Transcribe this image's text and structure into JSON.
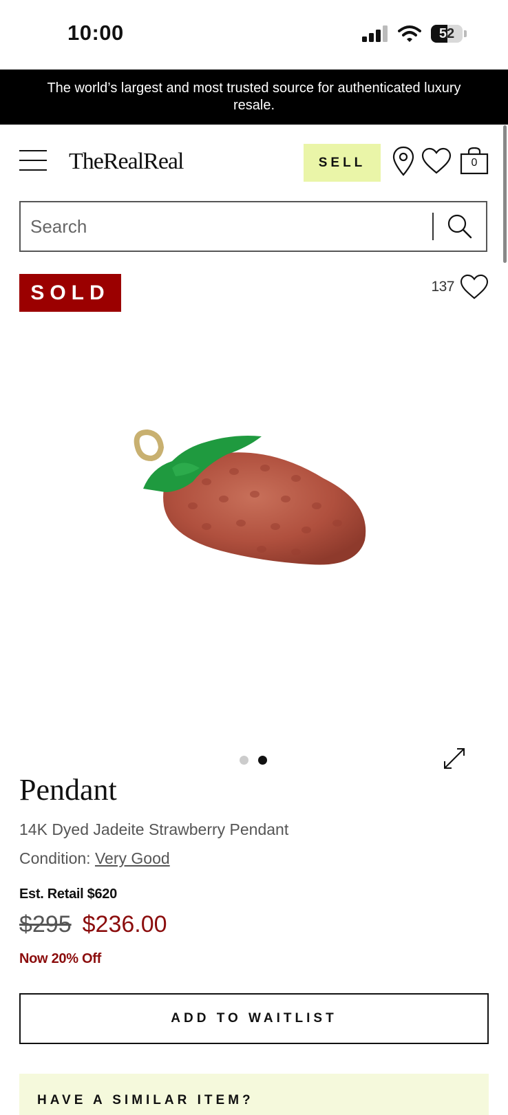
{
  "status_bar": {
    "time": "10:00",
    "battery": "52",
    "battery_level": 0.52
  },
  "banner": {
    "text": "The world’s largest and most trusted source for authenticated luxury resale."
  },
  "header": {
    "logo": "TheRealReal",
    "sell_label": "SELL",
    "bag_count": "0"
  },
  "search": {
    "placeholder": "Search"
  },
  "product": {
    "sold_label": "SOLD",
    "favorite_count": "137",
    "gallery": {
      "total_images": 2,
      "active_index": 1
    },
    "title": "Pendant",
    "subtitle": "14K Dyed Jadeite Strawberry Pendant",
    "condition_label": "Condition:",
    "condition_value": "Very Good",
    "est_retail": "Est. Retail $620",
    "original_price": "$295",
    "sale_price": "$236.00",
    "discount_text": "Now 20% Off"
  },
  "actions": {
    "waitlist_label": "ADD TO WAITLIST"
  },
  "similar": {
    "heading": "HAVE A SIMILAR ITEM?"
  },
  "colors": {
    "sold_red": "#9b0000",
    "price_red": "#8b0d0d",
    "sell_bg": "#eaf5a8",
    "similar_bg": "#f5f9dc"
  },
  "icons": [
    "menu-icon",
    "location-pin-icon",
    "heart-icon",
    "shopping-bag-icon",
    "search-icon",
    "expand-icon"
  ]
}
